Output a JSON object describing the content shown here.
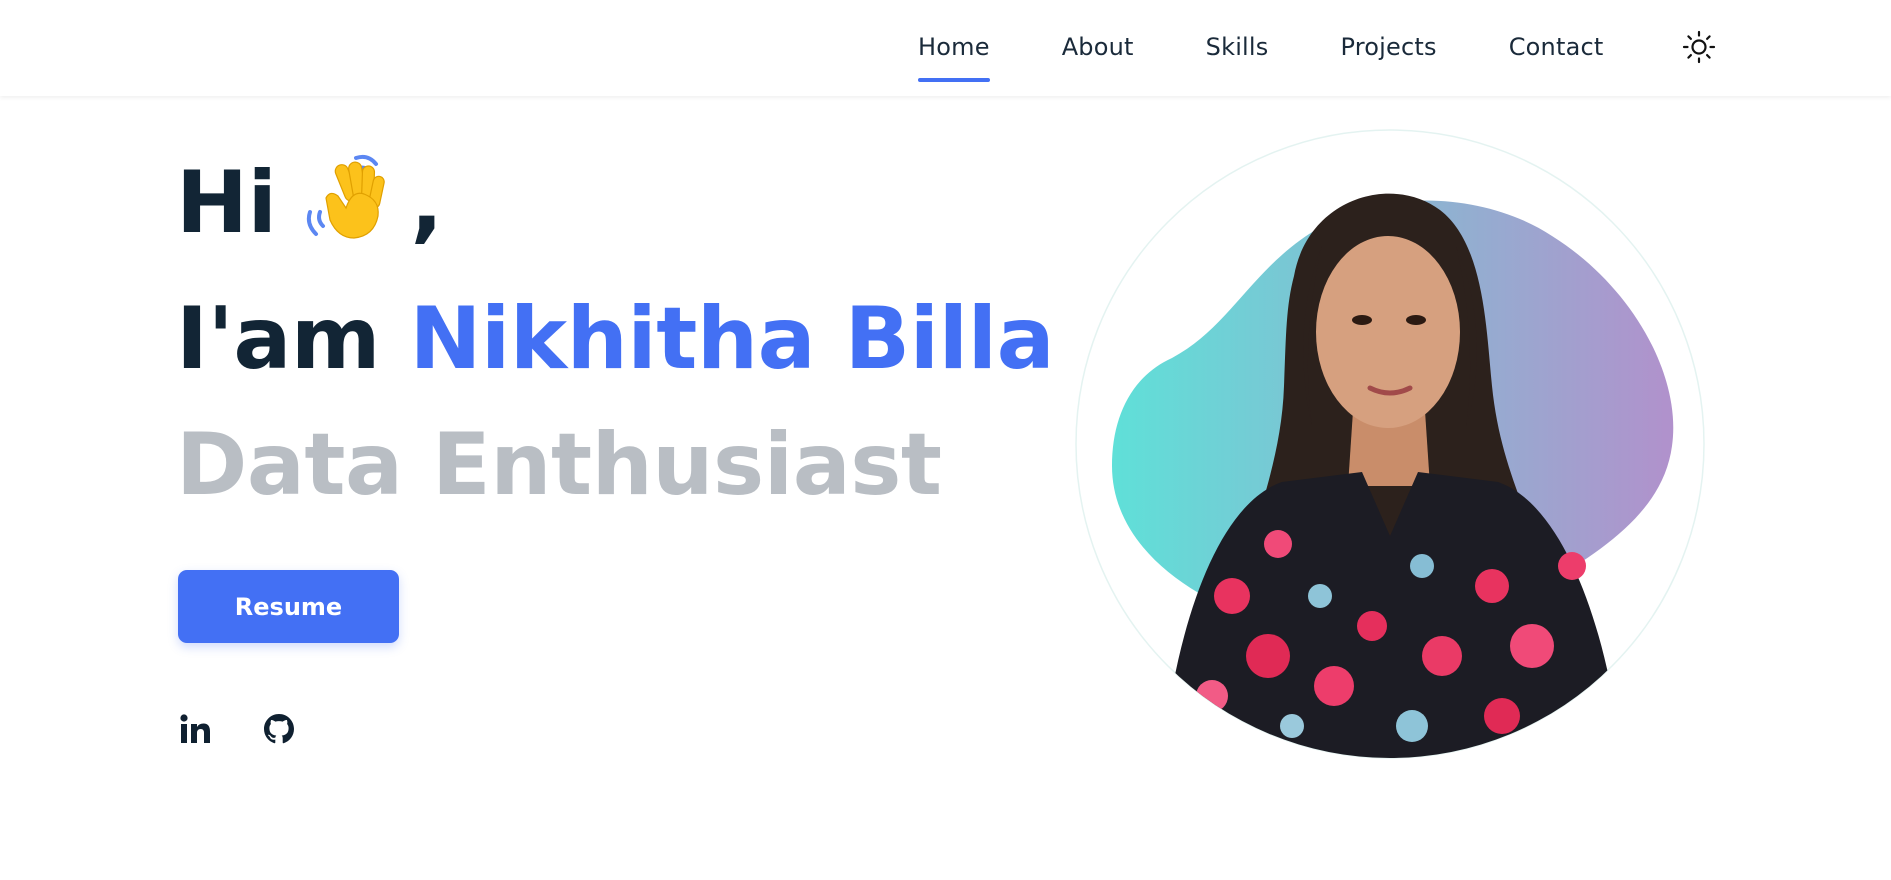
{
  "nav": {
    "items": [
      {
        "label": "Home",
        "active": true
      },
      {
        "label": "About",
        "active": false
      },
      {
        "label": "Skills",
        "active": false
      },
      {
        "label": "Projects",
        "active": false
      },
      {
        "label": "Contact",
        "active": false
      }
    ],
    "theme_toggle_icon": "sun-icon"
  },
  "hero": {
    "greeting": "Hi",
    "greeting_suffix": ",",
    "wave_icon": "waving-hand-icon",
    "intro_prefix": "I'am",
    "name": "Nikhitha Billa",
    "role": "Data Enthusiast",
    "resume_label": "Resume",
    "social": [
      {
        "icon": "linkedin-icon"
      },
      {
        "icon": "github-icon"
      }
    ]
  },
  "colors": {
    "accent": "#4370f4",
    "heading": "#122535",
    "muted": "#b9bec4",
    "blob_start": "#5fe0d8",
    "blob_end": "#b191cc"
  }
}
